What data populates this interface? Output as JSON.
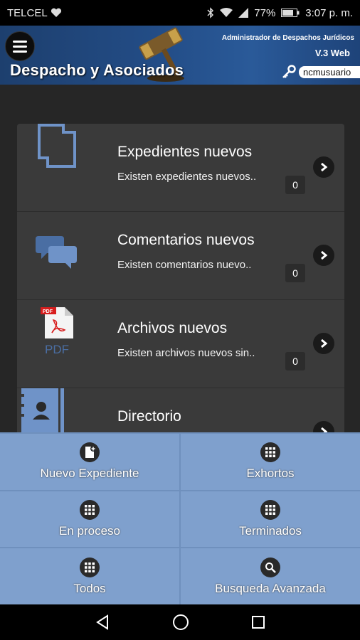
{
  "status_bar": {
    "carrier": "TELCEL",
    "battery": "77%",
    "time": "3:07 p. m."
  },
  "header": {
    "brand": "Despacho y Asociados",
    "subtitle": "Administrador de Despachos Jurídicos",
    "version": "V.3 Web",
    "username": "ncmusuario"
  },
  "items": [
    {
      "title": "Expedientes nuevos",
      "desc": "Existen expedientes nuevos..",
      "count": "0",
      "icon": "copy-documents-icon"
    },
    {
      "title": "Comentarios nuevos",
      "desc": "Existen comentarios nuevo..",
      "count": "0",
      "icon": "chat-bubbles-icon"
    },
    {
      "title": "Archivos nuevos",
      "desc": "Existen archivos nuevos sin..",
      "count": "0",
      "icon": "pdf-file-icon",
      "icon_caption": "PDF"
    },
    {
      "title": "Directorio",
      "icon": "address-book-icon"
    }
  ],
  "nav_grid": [
    {
      "label": "Nuevo Expediente",
      "icon": "new-document-icon"
    },
    {
      "label": "Exhortos",
      "icon": "grid-icon"
    },
    {
      "label": "En proceso",
      "icon": "grid-icon"
    },
    {
      "label": "Terminados",
      "icon": "grid-icon"
    },
    {
      "label": "Todos",
      "icon": "grid-icon"
    },
    {
      "label": "Busqueda Avanzada",
      "icon": "search-icon"
    }
  ],
  "colors": {
    "header_blue": "#234d87",
    "grid_blue": "#7fa0cd",
    "icon_blue": "#6f93c8"
  }
}
